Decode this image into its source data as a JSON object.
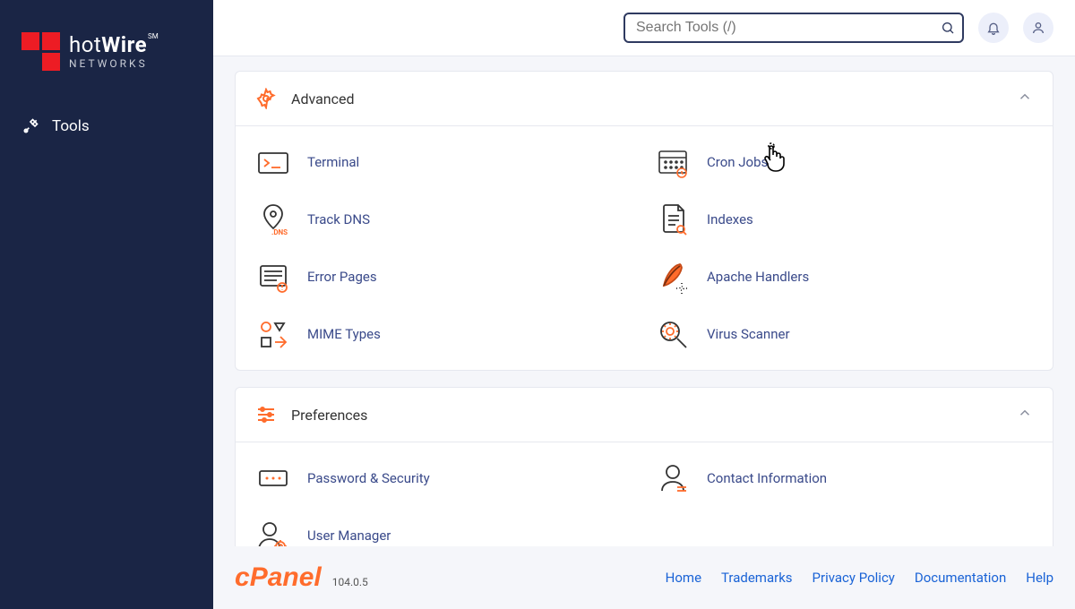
{
  "brand": {
    "name": "hotWire",
    "sub": "NETWORKS",
    "sm": "SM"
  },
  "sidebar": {
    "items": [
      {
        "label": "Tools"
      }
    ]
  },
  "search": {
    "placeholder": "Search Tools (/)"
  },
  "panels": {
    "advanced": {
      "title": "Advanced",
      "items": [
        {
          "label": "Terminal"
        },
        {
          "label": "Cron Jobs"
        },
        {
          "label": "Track DNS"
        },
        {
          "label": "Indexes"
        },
        {
          "label": "Error Pages"
        },
        {
          "label": "Apache Handlers"
        },
        {
          "label": "MIME Types"
        },
        {
          "label": "Virus Scanner"
        }
      ]
    },
    "preferences": {
      "title": "Preferences",
      "items": [
        {
          "label": "Password & Security"
        },
        {
          "label": "Contact Information"
        },
        {
          "label": "User Manager"
        }
      ]
    }
  },
  "footer": {
    "product": "cPanel",
    "version": "104.0.5",
    "links": [
      {
        "label": "Home"
      },
      {
        "label": "Trademarks"
      },
      {
        "label": "Privacy Policy"
      },
      {
        "label": "Documentation"
      },
      {
        "label": "Help"
      }
    ]
  }
}
